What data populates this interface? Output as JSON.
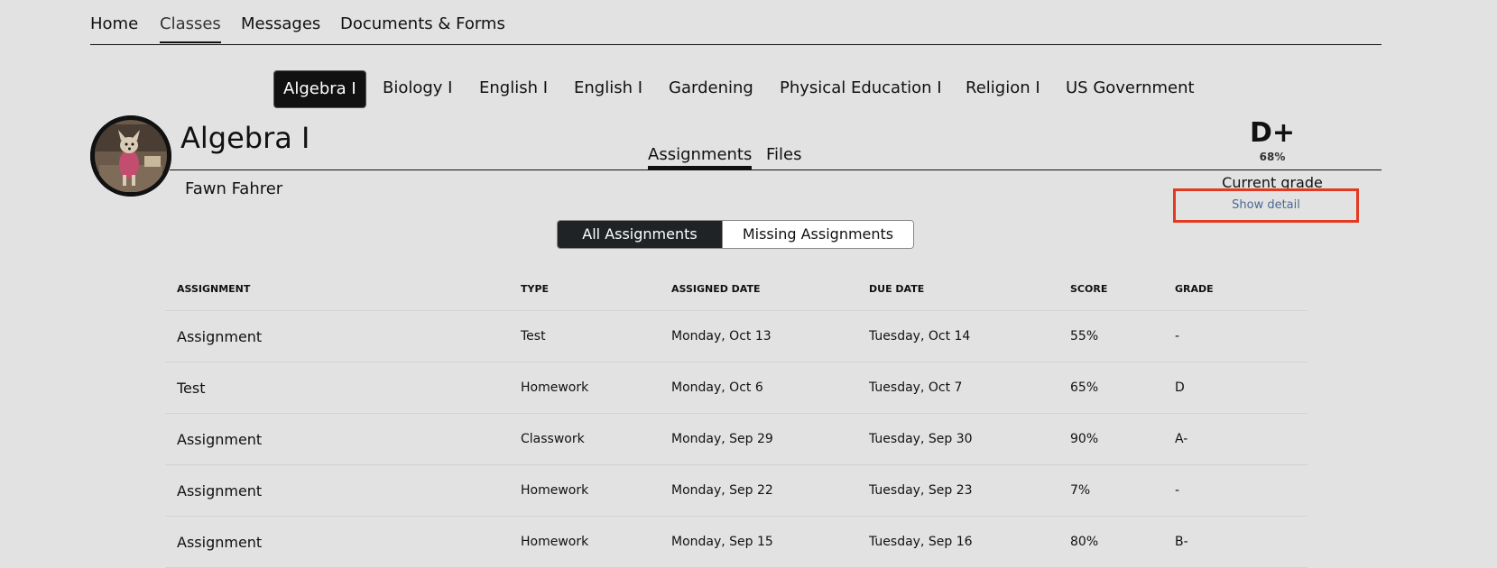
{
  "top_nav": [
    "Home",
    "Classes",
    "Messages",
    "Documents & Forms"
  ],
  "class_tabs": [
    "Algebra I",
    "Biology I",
    "English I",
    "English I",
    "Gardening",
    "Physical Education I",
    "Religion I",
    "US Government"
  ],
  "class": {
    "title": "Algebra I",
    "teacher": "Fawn Fahrer"
  },
  "sub_tabs": [
    "Assignments",
    "Files"
  ],
  "grade": {
    "letter": "D+",
    "percent": "68%",
    "caption": "Current grade",
    "detail_link": "Show detail"
  },
  "filter": {
    "all": "All Assignments",
    "missing": "Missing Assignments"
  },
  "table": {
    "headers": [
      "ASSIGNMENT",
      "TYPE",
      "ASSIGNED DATE",
      "DUE DATE",
      "SCORE",
      "GRADE"
    ],
    "rows": [
      [
        "Assignment",
        "Test",
        "Monday, Oct 13",
        "Tuesday, Oct 14",
        "55%",
        "-"
      ],
      [
        "Test",
        "Homework",
        "Monday, Oct 6",
        "Tuesday, Oct 7",
        "65%",
        "D"
      ],
      [
        "Assignment",
        "Classwork",
        "Monday, Sep 29",
        "Tuesday, Sep 30",
        "90%",
        "A-"
      ],
      [
        "Assignment",
        "Homework",
        "Monday, Sep 22",
        "Tuesday, Sep 23",
        "7%",
        "-"
      ],
      [
        "Assignment",
        "Homework",
        "Monday, Sep 15",
        "Tuesday, Sep 16",
        "80%",
        "B-"
      ]
    ]
  },
  "colors": {
    "background": "#e2e2e2",
    "highlight_box": "#e33a22",
    "link": "#4a6a94",
    "active_tab": "#111111"
  }
}
